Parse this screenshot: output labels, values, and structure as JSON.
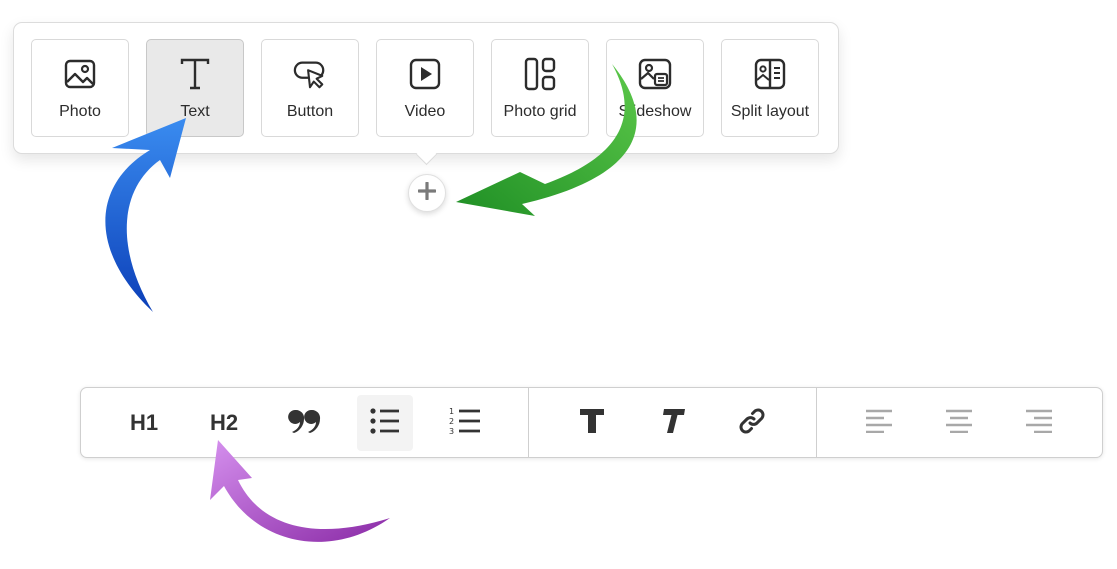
{
  "block_menu": {
    "items": [
      {
        "label": "Photo",
        "icon": "image-icon"
      },
      {
        "label": "Text",
        "icon": "text-icon",
        "selected": true
      },
      {
        "label": "Button",
        "icon": "button-cursor-icon"
      },
      {
        "label": "Video",
        "icon": "video-play-icon"
      },
      {
        "label": "Photo grid",
        "icon": "photo-grid-icon"
      },
      {
        "label": "Slideshow",
        "icon": "slideshow-icon"
      },
      {
        "label": "Split layout",
        "icon": "split-layout-icon"
      }
    ]
  },
  "add_button": {
    "icon": "plus-icon"
  },
  "text_toolbar": {
    "heading1_label": "H1",
    "heading2_label": "H2",
    "quote_icon": "quote-icon",
    "bullet_list_icon": "bullet-list-icon",
    "numbered_list_icon": "numbered-list-icon",
    "bold_icon": "bold-icon",
    "italic_icon": "italic-icon",
    "link_icon": "link-icon",
    "align_left_icon": "align-left-icon",
    "align_center_icon": "align-center-icon",
    "align_right_icon": "align-right-icon"
  },
  "annotations": {
    "blue_arrow_color": "#1a5fd6",
    "green_arrow_color": "#2ea42e",
    "purple_arrow_color": "#a040c0"
  }
}
